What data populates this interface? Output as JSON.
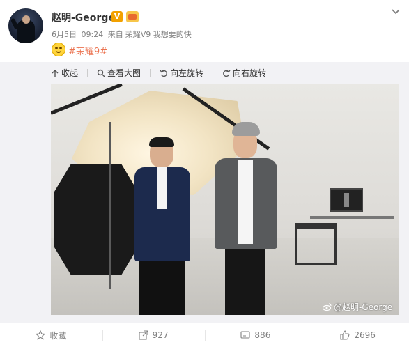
{
  "post": {
    "username": "赵明-George",
    "verified_badge": "V",
    "meta": {
      "date": "6月5日",
      "time": "09:24",
      "source_prefix": "来自",
      "source": "荣耀V9 我想要的快"
    },
    "emoji": "smile-emoji",
    "hashtag": "#荣耀9#",
    "watermark": "@赵明-George"
  },
  "image_toolbar": {
    "collapse_label": "收起",
    "view_large_label": "查看大图",
    "rotate_left_label": "向左旋转",
    "rotate_right_label": "向右旋转"
  },
  "actions": {
    "favorite_label": "收藏",
    "repost_count": "927",
    "comment_count": "886",
    "like_count": "2696"
  },
  "colors": {
    "hashtag": "#eb7350",
    "verified_badge": "#f2a100",
    "meta_text": "#808080"
  }
}
